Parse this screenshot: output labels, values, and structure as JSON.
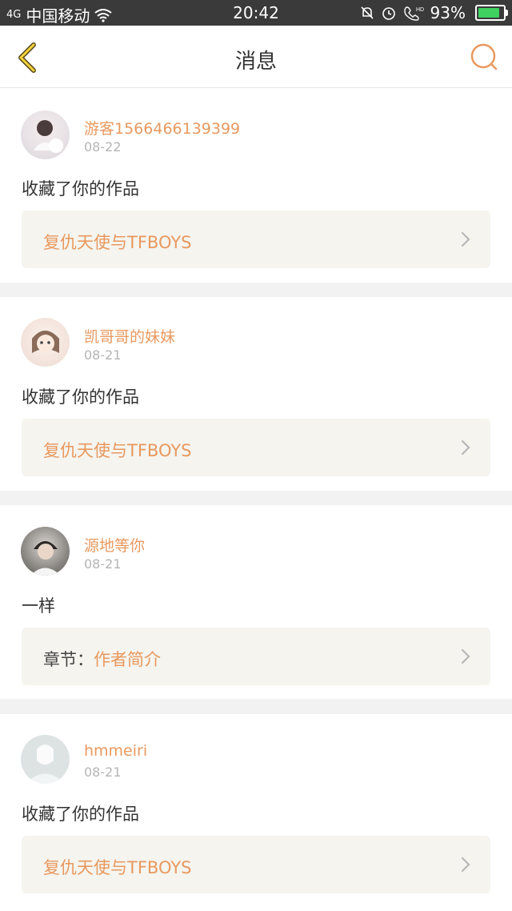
{
  "status_bar": {
    "signal_text": "4G",
    "carrier": "中国移动",
    "time": "20:42",
    "battery": "93%",
    "icons": [
      "wifi-icon",
      "mute-bell-icon",
      "alarm-icon",
      "hd-call-icon",
      "battery-icon"
    ]
  },
  "nav": {
    "title": "消息",
    "back_icon": "chevron-left-icon",
    "search_icon": "search-icon",
    "accent": "#e8995f"
  },
  "messages": [
    {
      "user": "游客1566466139399",
      "date": "08-22",
      "text": "收藏了你的作品",
      "link_prefix": "",
      "link_text": "复仇天使与TFBOYS"
    },
    {
      "user": "凯哥哥的妹妹",
      "date": "08-21",
      "text": "收藏了你的作品",
      "link_prefix": "",
      "link_text": "复仇天使与TFBOYS"
    },
    {
      "user": "源地等你",
      "date": "08-21",
      "text": "一样",
      "link_prefix": "章节：",
      "link_text": "作者简介"
    },
    {
      "user": "hmmeiri",
      "date": "08-21",
      "text": "收藏了你的作品",
      "link_prefix": "",
      "link_text": "复仇天使与TFBOYS"
    }
  ]
}
